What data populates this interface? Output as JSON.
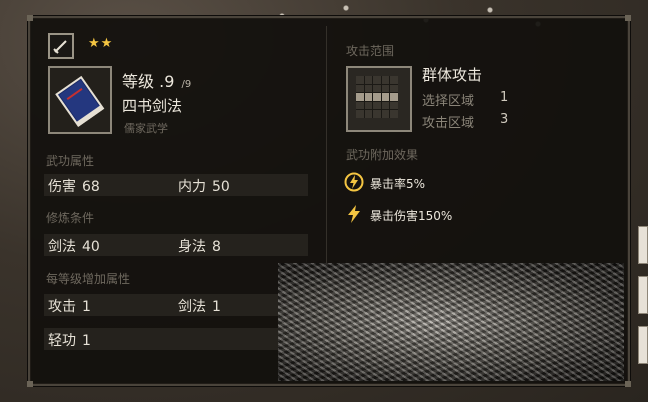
{
  "colors": {
    "gold": "#f4c542",
    "text": "#ece7dc",
    "muted": "#6e685e",
    "row_bg": "#25221d"
  },
  "header": {
    "weapon_icon": "sword-icon",
    "stars": "★★",
    "level_label": "等级",
    "level_value": ".9",
    "level_max": "/9",
    "skill_name": "四书剑法",
    "school": "儒家武学",
    "book_icon": "book-icon"
  },
  "attributes": {
    "title": "武功属性",
    "row": [
      {
        "label": "伤害",
        "value": "68"
      },
      {
        "label": "内力",
        "value": "50"
      }
    ]
  },
  "requirements": {
    "title": "修炼条件",
    "row": [
      {
        "label": "剑法",
        "value": "40"
      },
      {
        "label": "身法",
        "value": "8"
      }
    ]
  },
  "per_level": {
    "title": "每等级增加属性",
    "rows": [
      [
        {
          "label": "攻击",
          "value": "1"
        },
        {
          "label": "剑法",
          "value": "1"
        }
      ],
      [
        {
          "label": "轻功",
          "value": "1"
        }
      ]
    ]
  },
  "attack_range": {
    "title": "攻击范围",
    "type": "群体攻击",
    "select_label": "选择区域",
    "select_value": "1",
    "attack_label": "攻击区域",
    "attack_value": "3"
  },
  "bonus": {
    "title": "武功附加效果",
    "items": [
      {
        "icon": "lightning-circle-icon",
        "text": "暴击率5%"
      },
      {
        "icon": "lightning-icon",
        "text": "暴击伤害150%"
      }
    ]
  }
}
